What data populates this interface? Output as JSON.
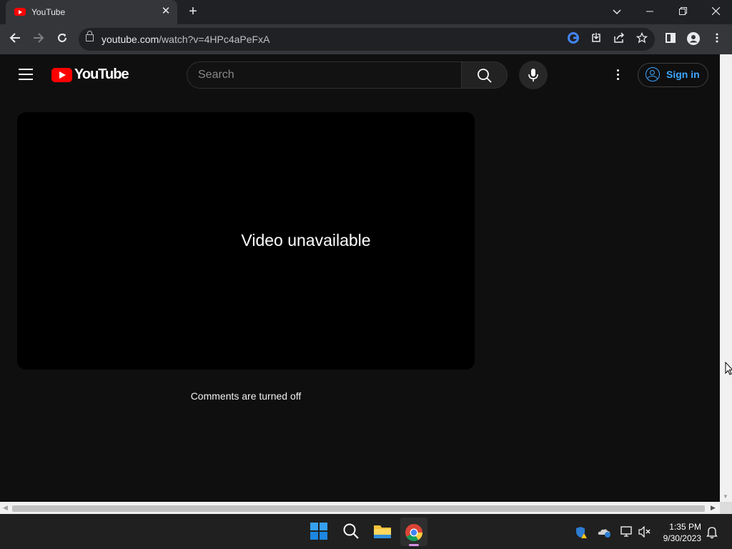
{
  "browser": {
    "tab_title": "YouTube",
    "tab_close": "✕",
    "new_tab": "+",
    "url_host": "youtube.com",
    "url_path": "/watch?v=4HPc4aPeFxA"
  },
  "youtube": {
    "wordmark": "YouTube",
    "search_placeholder": "Search",
    "signin_label": "Sign in",
    "player_message": "Video unavailable",
    "comments_status": "Comments are turned off"
  },
  "taskbar": {
    "time": "1:35 PM",
    "date": "9/30/2023"
  },
  "colors": {
    "youtube_red": "#ff0000",
    "signin_blue": "#3ea6ff",
    "page_bg": "#0f0f0f"
  }
}
